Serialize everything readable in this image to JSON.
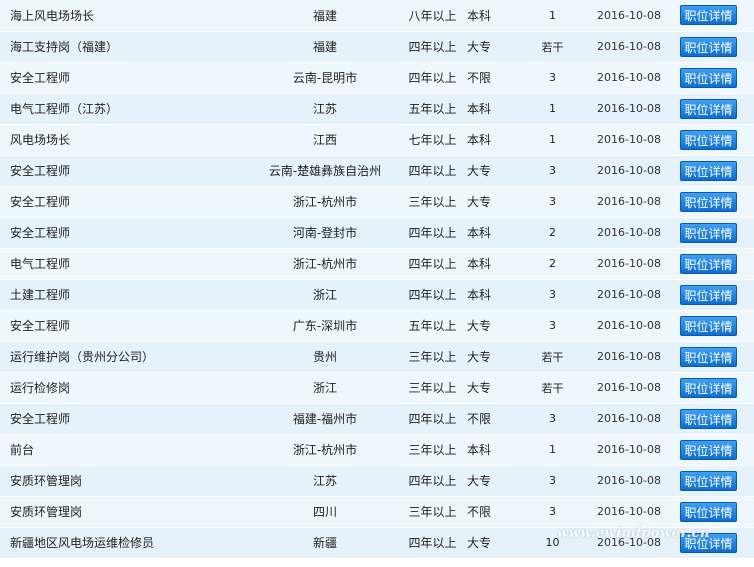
{
  "rows": [
    {
      "title": "海上风电场场长",
      "location": "福建",
      "experience": "八年以上",
      "education": "本科",
      "headcount": "1",
      "date": "2016-10-08",
      "action": "职位详情"
    },
    {
      "title": "海工支持岗（福建）",
      "location": "福建",
      "experience": "四年以上",
      "education": "大专",
      "headcount": "若干",
      "date": "2016-10-08",
      "action": "职位详情"
    },
    {
      "title": "安全工程师",
      "location": "云南-昆明市",
      "experience": "四年以上",
      "education": "不限",
      "headcount": "3",
      "date": "2016-10-08",
      "action": "职位详情"
    },
    {
      "title": "电气工程师（江苏）",
      "location": "江苏",
      "experience": "五年以上",
      "education": "本科",
      "headcount": "1",
      "date": "2016-10-08",
      "action": "职位详情"
    },
    {
      "title": "风电场场长",
      "location": "江西",
      "experience": "七年以上",
      "education": "本科",
      "headcount": "1",
      "date": "2016-10-08",
      "action": "职位详情"
    },
    {
      "title": "安全工程师",
      "location": "云南-楚雄彝族自治州",
      "experience": "四年以上",
      "education": "大专",
      "headcount": "3",
      "date": "2016-10-08",
      "action": "职位详情"
    },
    {
      "title": "安全工程师",
      "location": "浙江-杭州市",
      "experience": "三年以上",
      "education": "大专",
      "headcount": "3",
      "date": "2016-10-08",
      "action": "职位详情"
    },
    {
      "title": "安全工程师",
      "location": "河南-登封市",
      "experience": "四年以上",
      "education": "本科",
      "headcount": "2",
      "date": "2016-10-08",
      "action": "职位详情"
    },
    {
      "title": "电气工程师",
      "location": "浙江-杭州市",
      "experience": "四年以上",
      "education": "本科",
      "headcount": "2",
      "date": "2016-10-08",
      "action": "职位详情"
    },
    {
      "title": "土建工程师",
      "location": "浙江",
      "experience": "四年以上",
      "education": "本科",
      "headcount": "3",
      "date": "2016-10-08",
      "action": "职位详情"
    },
    {
      "title": "安全工程师",
      "location": "广东-深圳市",
      "experience": "五年以上",
      "education": "大专",
      "headcount": "3",
      "date": "2016-10-08",
      "action": "职位详情"
    },
    {
      "title": "运行维护岗（贵州分公司）",
      "location": "贵州",
      "experience": "三年以上",
      "education": "大专",
      "headcount": "若干",
      "date": "2016-10-08",
      "action": "职位详情"
    },
    {
      "title": "运行检修岗",
      "location": "浙江",
      "experience": "三年以上",
      "education": "大专",
      "headcount": "若干",
      "date": "2016-10-08",
      "action": "职位详情"
    },
    {
      "title": "安全工程师",
      "location": "福建-福州市",
      "experience": "四年以上",
      "education": "不限",
      "headcount": "3",
      "date": "2016-10-08",
      "action": "职位详情"
    },
    {
      "title": "前台",
      "location": "浙江-杭州市",
      "experience": "三年以上",
      "education": "本科",
      "headcount": "1",
      "date": "2016-10-08",
      "action": "职位详情"
    },
    {
      "title": "安质环管理岗",
      "location": "江苏",
      "experience": "四年以上",
      "education": "大专",
      "headcount": "3",
      "date": "2016-10-08",
      "action": "职位详情"
    },
    {
      "title": "安质环管理岗",
      "location": "四川",
      "experience": "三年以上",
      "education": "不限",
      "headcount": "3",
      "date": "2016-10-08",
      "action": "职位详情"
    },
    {
      "title": "新疆地区风电场运维检修员",
      "location": "新疆",
      "experience": "四年以上",
      "education": "大专",
      "headcount": "10",
      "date": "2016-10-08",
      "action": "职位详情"
    }
  ],
  "watermark": "www.ewindpower.cn",
  "colors": {
    "row_odd": "#eef7fb",
    "row_even": "#e6f2f9",
    "button_top": "#3f9ff0",
    "button_bottom": "#0f6fd0"
  }
}
